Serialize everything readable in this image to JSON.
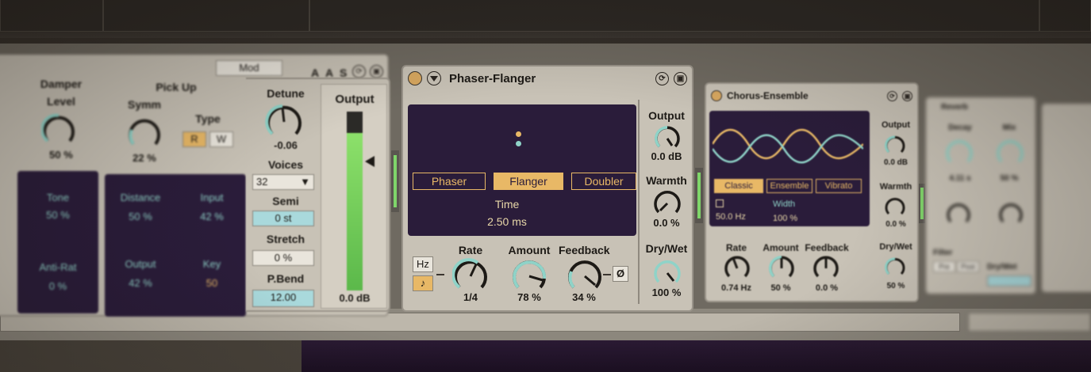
{
  "left_device": {
    "mod_label": "Mod",
    "header_buttons": [
      "A",
      "A",
      "S"
    ],
    "damper": {
      "title": "Damper",
      "level_label": "Level",
      "level_value": "50 %"
    },
    "pickup": {
      "title": "Pick Up",
      "symm_label": "Symm",
      "symm_value": "22 %",
      "type_label": "Type",
      "type_options": [
        "R",
        "W"
      ]
    },
    "tone_panel": {
      "tone_label": "Tone",
      "tone_value": "50 %",
      "ani_label": "Anti-Rat",
      "ani_value": "0 %"
    },
    "pickup_panel": {
      "distance_label": "Distance",
      "distance_value": "50 %",
      "input_label": "Input",
      "input_value": "42 %",
      "output_label": "Output",
      "output_value": "42 %",
      "key_label": "Key",
      "key_value": "50"
    },
    "detune": {
      "label": "Detune",
      "value": "-0.06"
    },
    "voices": {
      "label": "Voices",
      "value": "32"
    },
    "semi": {
      "label": "Semi",
      "value": "0 st"
    },
    "stretch": {
      "label": "Stretch",
      "value": "0 %"
    },
    "pbend": {
      "label": "P.Bend",
      "value": "12.00"
    },
    "output": {
      "label": "Output",
      "value": "0.0 dB",
      "level": 0.88
    }
  },
  "phaser": {
    "title": "Phaser-Flanger",
    "modes": [
      "Phaser",
      "Flanger",
      "Doubler"
    ],
    "active_mode": "Flanger",
    "time_label": "Time",
    "time_value": "2.50 ms",
    "rate_label": "Rate",
    "rate_value": "1/4",
    "hz_label": "Hz",
    "note_icon": "♪",
    "amount_label": "Amount",
    "amount_value": "78 %",
    "feedback_label": "Feedback",
    "feedback_value": "34 %",
    "phase_label": "Ø",
    "output_label": "Output",
    "output_value": "0.0 dB",
    "warmth_label": "Warmth",
    "warmth_value": "0.0 %",
    "drywet_label": "Dry/Wet",
    "drywet_value": "100 %"
  },
  "chorus": {
    "title": "Chorus-Ensemble",
    "modes": [
      "Classic",
      "Ensemble",
      "Vibrato"
    ],
    "active_mode": "Classic",
    "hz_value": "50.0 Hz",
    "width_label": "Width",
    "width_value": "100 %",
    "rate_label": "Rate",
    "rate_value": "0.74 Hz",
    "amount_label": "Amount",
    "amount_value": "50 %",
    "feedback_label": "Feedback",
    "feedback_value": "0.0 %",
    "output_label": "Output",
    "output_value": "0.0 dB",
    "warmth_label": "Warmth",
    "warmth_value": "0.0 %",
    "drywet_label": "Dry/Wet",
    "drywet_value": "50 %"
  },
  "right_device": {
    "title": "Reverb",
    "decay_label": "Decay",
    "decay_value": "4.11 s",
    "mix_label": "Mix",
    "mix_value": "50 %",
    "filter_label": "Filter",
    "filter_options": [
      "Pre",
      "Post"
    ],
    "drywet_label": "Dry/Wet"
  },
  "colors": {
    "accent": "#e8b866",
    "screen": "#2a1c3a",
    "panel": "#c8c2b6",
    "cyan_field": "#a9d9dc",
    "wave_a": "#e8b866",
    "wave_b": "#8fd3c8"
  }
}
